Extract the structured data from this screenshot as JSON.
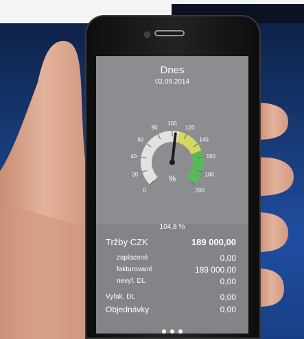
{
  "screen": {
    "title": "Dnes",
    "date": "02.09.2014",
    "gauge": {
      "value": 104.8,
      "min": 0,
      "max": 200,
      "ticks": [
        "0",
        "20",
        "40",
        "60",
        "80",
        "100",
        "120",
        "140",
        "160",
        "180",
        "200"
      ],
      "unit_label": "%",
      "readout": "104,8 %",
      "colors": {
        "neutral": "#e2e2e2",
        "yellow": "#d6d960",
        "green": "#5ab85b",
        "needle": "#1d1d1d"
      }
    },
    "summary": {
      "revenue_label": "Tržby CZK",
      "revenue_value": "189 000,00",
      "rows": [
        {
          "label": "zaplacené",
          "value": "0,00"
        },
        {
          "label": "fakturované",
          "value": "189 000,00"
        },
        {
          "label": "nevyf. DL",
          "value": "0,00"
        }
      ],
      "invoiced_dn_label": "Vyfak. DL",
      "invoiced_dn_value": "0,00",
      "orders_label": "Objednávky",
      "orders_value": "0,00"
    },
    "page_indicator": {
      "count": 3,
      "active": 0
    }
  }
}
